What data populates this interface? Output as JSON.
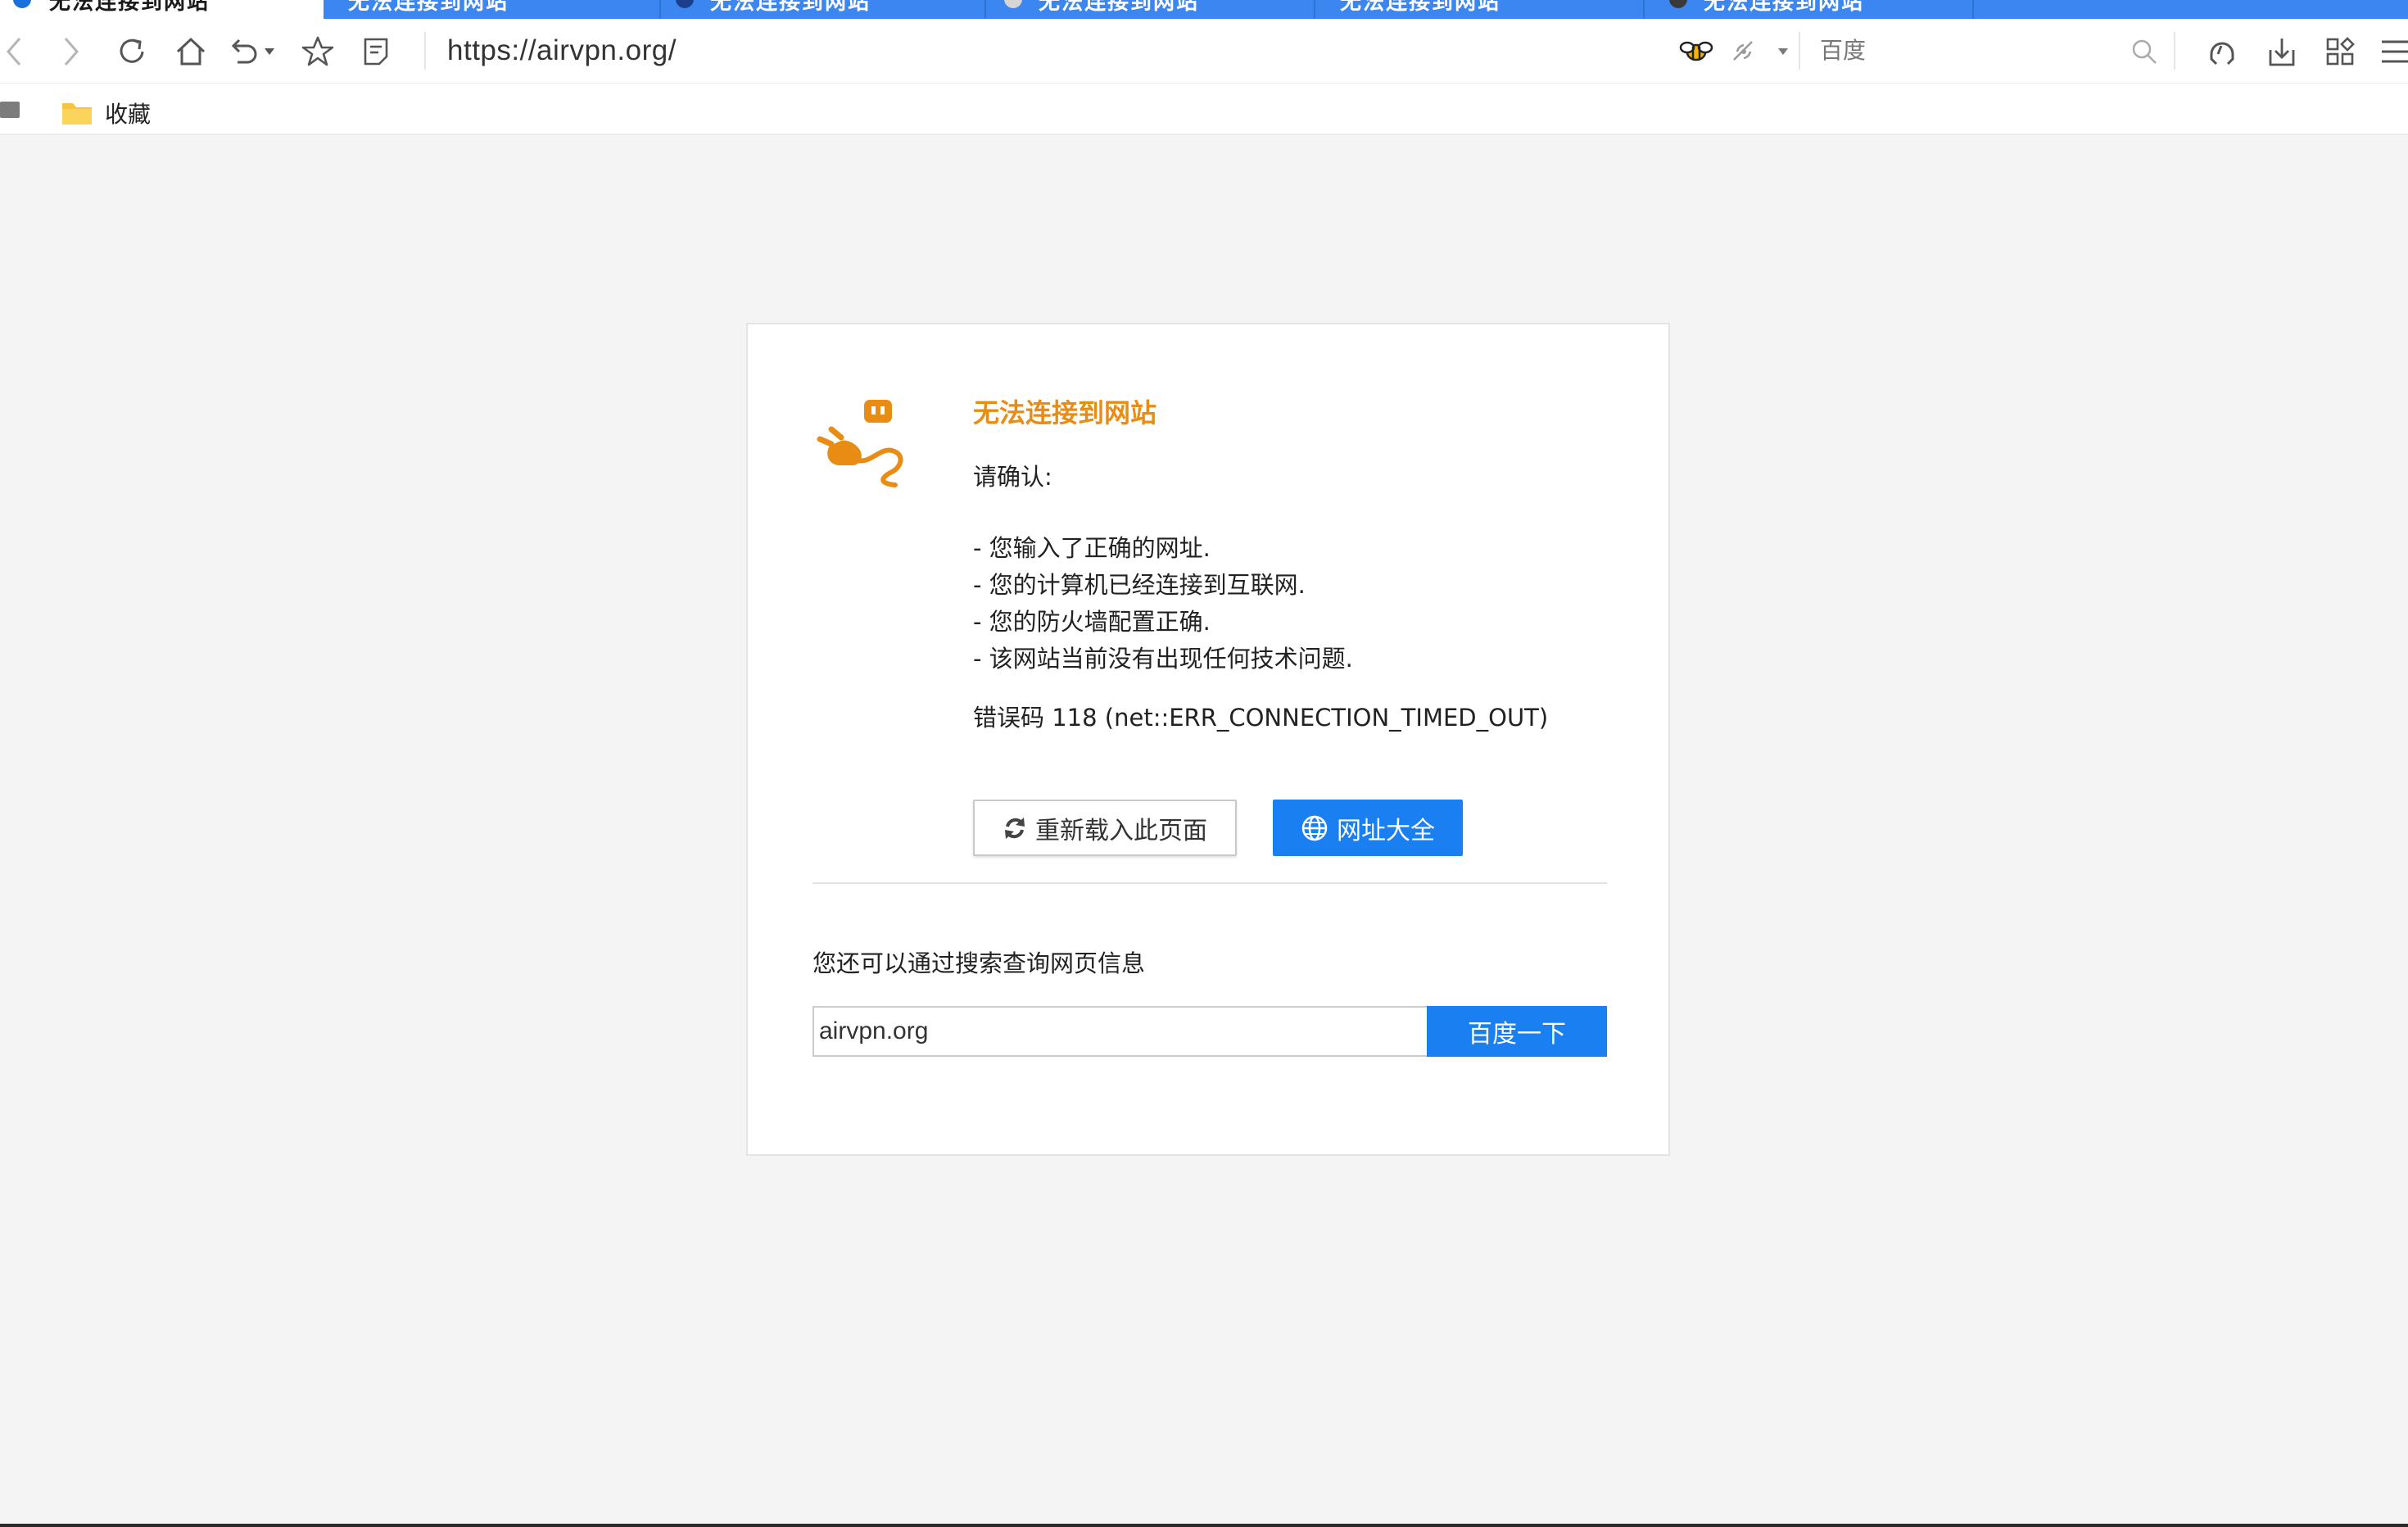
{
  "browser": {
    "tabs": [
      {
        "title": "无法连接到网站",
        "active": true
      },
      {
        "title": "无法连接到网站",
        "active": false
      },
      {
        "title": "无法连接到网站",
        "active": false
      },
      {
        "title": "无法连接到网站",
        "active": false
      },
      {
        "title": "无法连接到网站",
        "active": false
      },
      {
        "title": "无法连接到网站",
        "active": false
      }
    ],
    "url": "https://airvpn.org/",
    "search_engine": "百度",
    "bookmarks": {
      "folder_label": "收藏"
    }
  },
  "error_page": {
    "title": "无法连接到网站",
    "confirm_label": "请确认:",
    "checklist": [
      "- 您输入了正确的网址.",
      "- 您的计算机已经连接到互联网.",
      "- 您的防火墙配置正确.",
      "- 该网站当前没有出现任何技术问题."
    ],
    "error_code": "错误码 118 (net::ERR_CONNECTION_TIMED_OUT)",
    "reload_button": "重新载入此页面",
    "sites_button": "网址大全",
    "search_hint": "您还可以通过搜索查询网页信息",
    "search_value": "airvpn.org",
    "search_button": "百度一下"
  },
  "colors": {
    "tab_strip": "#3b86f0",
    "accent_blue": "#1a80f2",
    "error_orange": "#e98c13",
    "page_bg": "#f4f4f4"
  },
  "icons": [
    "back-icon",
    "forward-icon",
    "reload-icon",
    "home-icon",
    "undo-icon",
    "star-icon",
    "reader-icon",
    "bee-extension-icon",
    "signal-icon",
    "search-icon",
    "headset-icon",
    "download-icon",
    "apps-icon",
    "menu-icon",
    "folder-icon",
    "plug-error-icon",
    "refresh-icon",
    "globe-icon"
  ]
}
